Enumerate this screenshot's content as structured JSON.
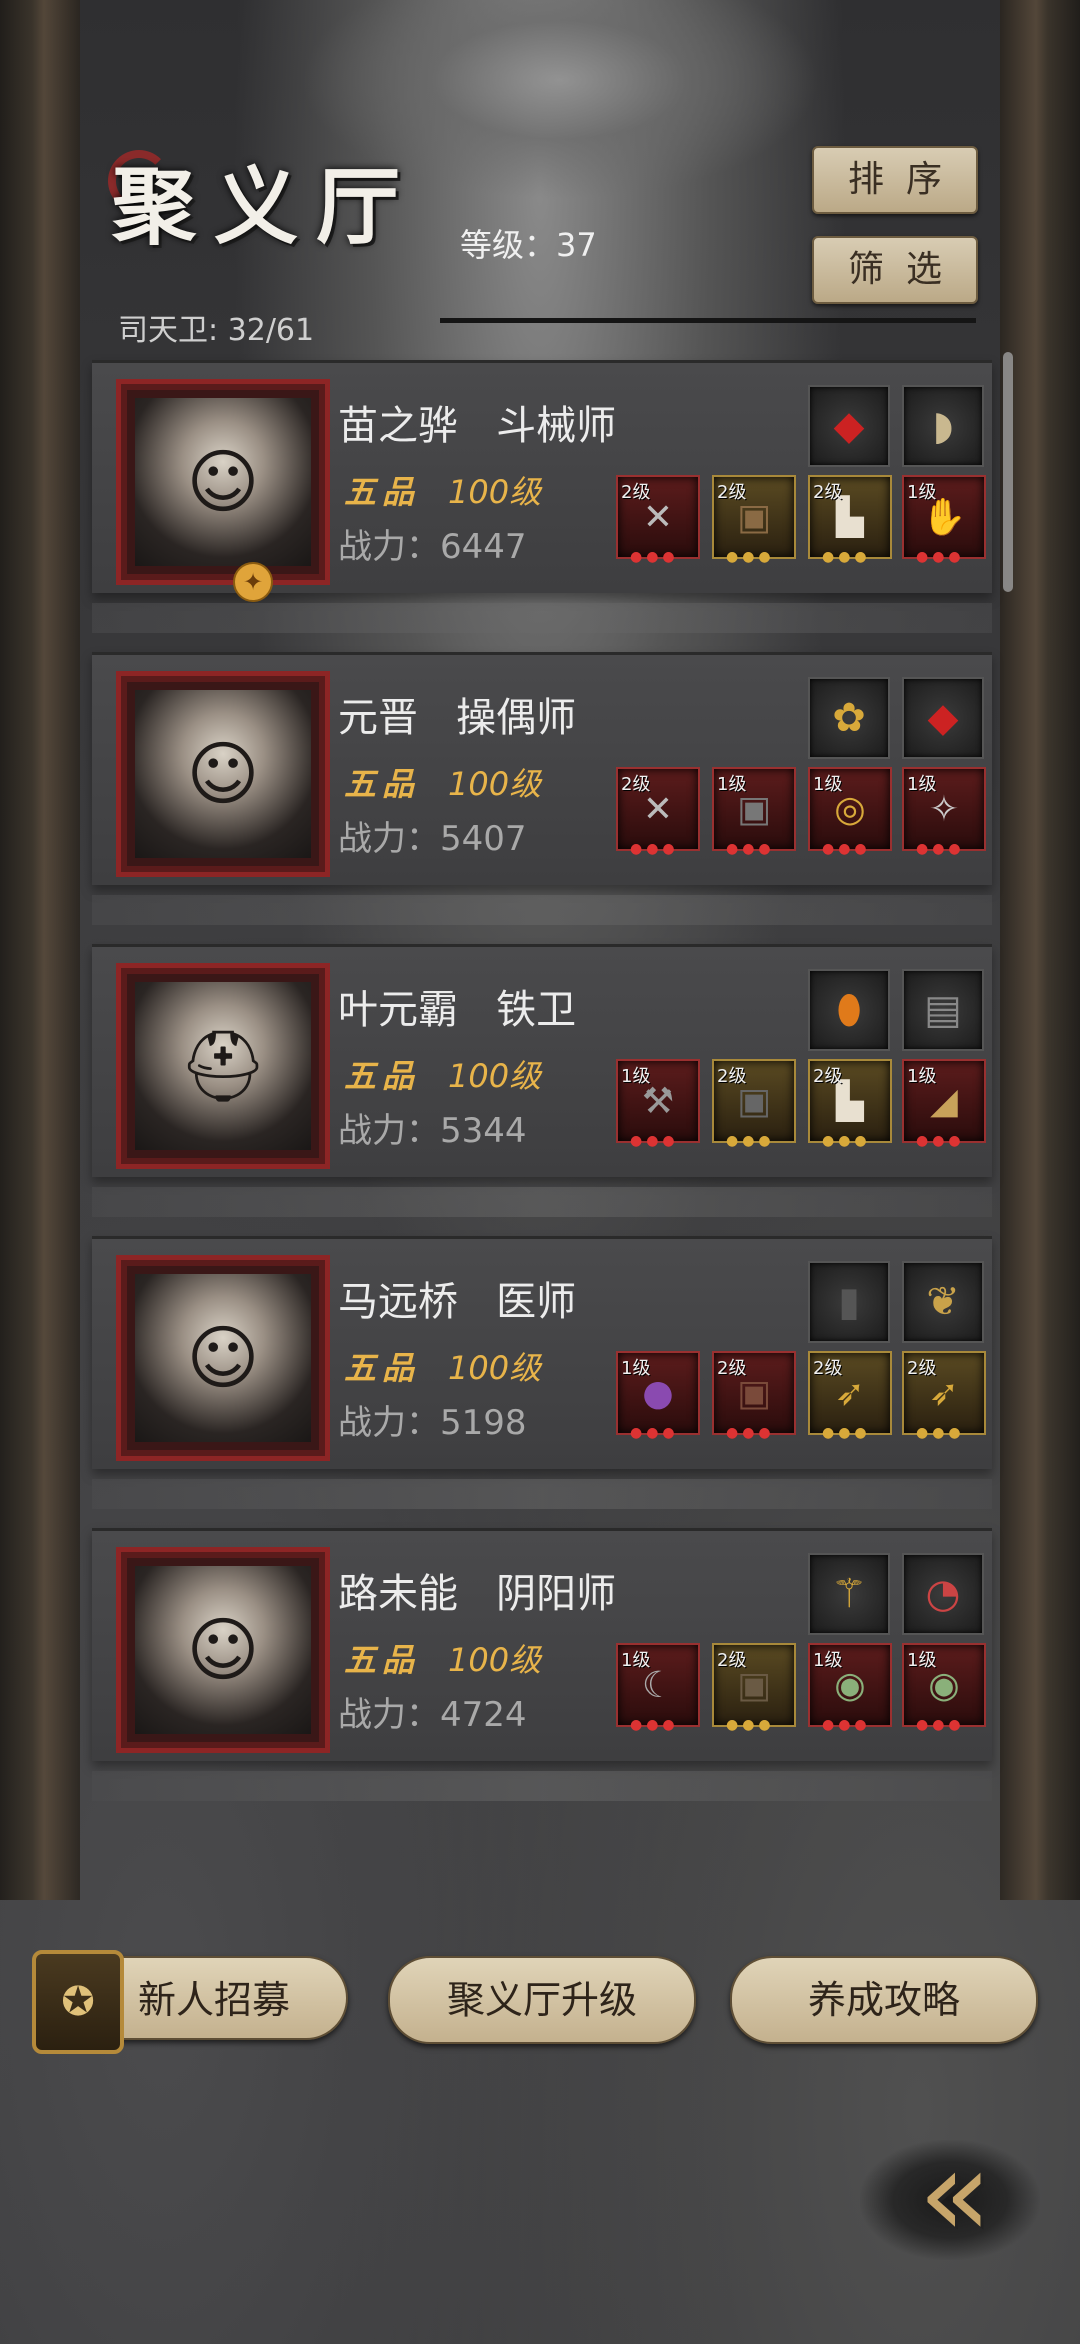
{
  "header": {
    "title": "聚义厅",
    "level_text": "等级：37",
    "guard_count": "司天卫: 32/61",
    "sort_label": "排序",
    "filter_label": "筛选"
  },
  "members": [
    {
      "name_title": "苗之骅   斗械师",
      "grade": "五品",
      "level": "100级",
      "power": "战力：6447",
      "accessories": [
        "crimson-gem-icon",
        "comb-icon"
      ],
      "equipment": [
        {
          "level": "2级",
          "icon": "crossbow-icon",
          "tier": "red"
        },
        {
          "level": "2级",
          "icon": "armor-icon",
          "tier": "gold"
        },
        {
          "level": "2级",
          "icon": "boots-icon",
          "tier": "gold"
        },
        {
          "level": "1级",
          "icon": "gauntlet-icon",
          "tier": "red"
        }
      ]
    },
    {
      "name_title": "元晋   操偶师",
      "grade": "五品",
      "level": "100级",
      "power": "战力：5407",
      "accessories": [
        "lotus-icon",
        "crimson-gem-icon"
      ],
      "equipment": [
        {
          "level": "2级",
          "icon": "crossbow-icon",
          "tier": "red"
        },
        {
          "level": "1级",
          "icon": "armor-icon",
          "tier": "red"
        },
        {
          "level": "1级",
          "icon": "bracer-icon",
          "tier": "red"
        },
        {
          "level": "1级",
          "icon": "amulet-icon",
          "tier": "red"
        }
      ]
    },
    {
      "name_title": "叶元霸   铁卫",
      "grade": "五品",
      "level": "100级",
      "power": "战力：5344",
      "accessories": [
        "amber-gem-icon",
        "box-icon"
      ],
      "equipment": [
        {
          "level": "1级",
          "icon": "hammer-icon",
          "tier": "red"
        },
        {
          "level": "2级",
          "icon": "armor-icon",
          "tier": "gold"
        },
        {
          "level": "2级",
          "icon": "boots-icon",
          "tier": "gold"
        },
        {
          "level": "1级",
          "icon": "helmet-icon",
          "tier": "red"
        }
      ]
    },
    {
      "name_title": "马远桥   医师",
      "grade": "五品",
      "level": "100级",
      "power": "战力：5198",
      "accessories": [
        "tablet-icon",
        "feather-icon"
      ],
      "equipment": [
        {
          "level": "1级",
          "icon": "gourd-icon",
          "tier": "red"
        },
        {
          "level": "2级",
          "icon": "armor-icon",
          "tier": "red"
        },
        {
          "level": "2级",
          "icon": "needle-icon",
          "tier": "gold"
        },
        {
          "level": "2级",
          "icon": "needle-icon",
          "tier": "gold"
        }
      ]
    },
    {
      "name_title": "路未能   阴阳师",
      "grade": "五品",
      "level": "100级",
      "power": "战力：4724",
      "accessories": [
        "staff-icon",
        "fan-icon"
      ],
      "equipment": [
        {
          "level": "1级",
          "icon": "scythe-icon",
          "tier": "red"
        },
        {
          "level": "2级",
          "icon": "armor-icon",
          "tier": "gold"
        },
        {
          "level": "1级",
          "icon": "coin-icon",
          "tier": "red"
        },
        {
          "level": "1级",
          "icon": "coin-icon",
          "tier": "red"
        }
      ]
    }
  ],
  "footer": {
    "recruit_label": "新人招募",
    "upgrade_label": "聚义厅升级",
    "guide_label": "养成攻略"
  }
}
